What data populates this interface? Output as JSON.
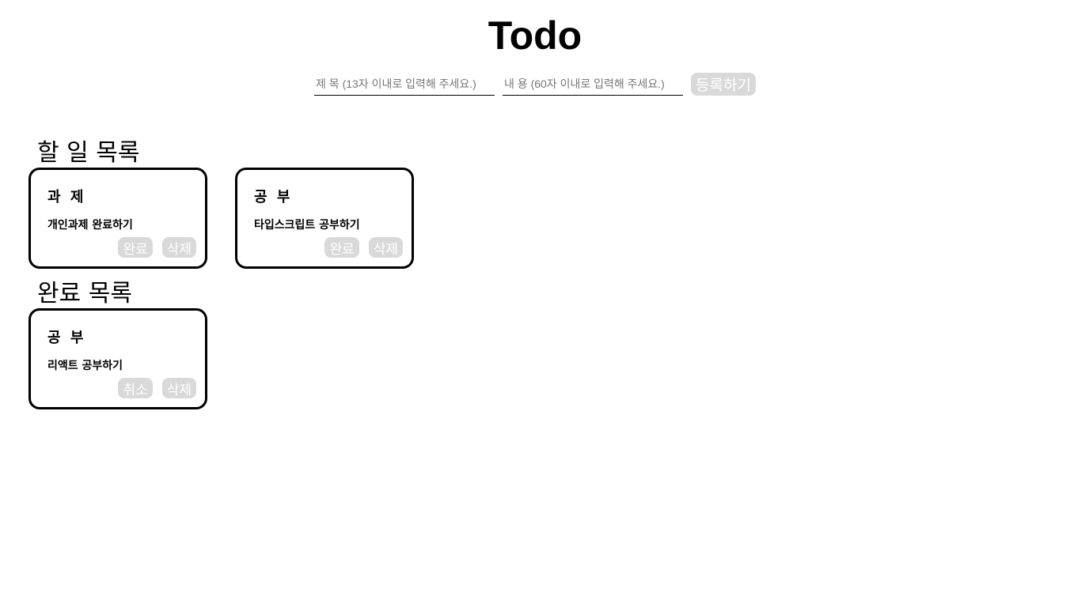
{
  "header": {
    "title": "Todo"
  },
  "form": {
    "title_placeholder": "제 목 (13자 이내로 입력해 주세요.)",
    "content_placeholder": "내 용 (60자 이내로 입력해 주세요.)",
    "submit_label": "등록하기"
  },
  "todo_section": {
    "title": "할 일 목록",
    "items": [
      {
        "title": "과 제",
        "content": "개인과제 완료하기",
        "primary_label": "완료",
        "delete_label": "삭제"
      },
      {
        "title": "공 부",
        "content": "타입스크립트 공부하기",
        "primary_label": "완료",
        "delete_label": "삭제"
      }
    ]
  },
  "done_section": {
    "title": "완료 목록",
    "items": [
      {
        "title": "공 부",
        "content": "리액트 공부하기",
        "primary_label": "취소",
        "delete_label": "삭제"
      }
    ]
  },
  "colors": {
    "button_bg": "#d9d9d9",
    "button_text": "#ffffff",
    "card_border": "#000000"
  }
}
